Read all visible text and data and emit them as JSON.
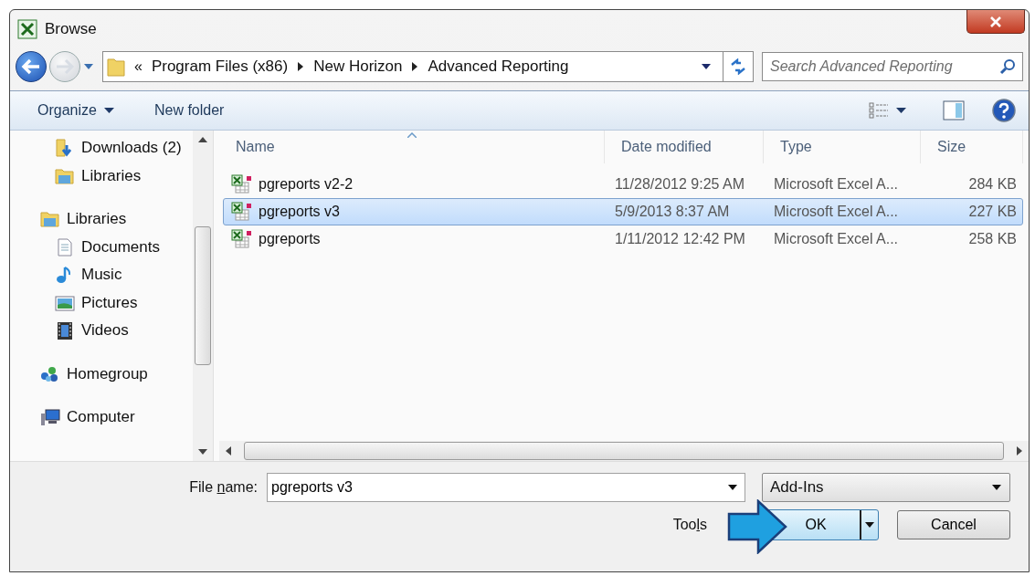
{
  "window": {
    "title": "Browse"
  },
  "address": {
    "path": [
      "Program Files (x86)",
      "New Horizon",
      "Advanced Reporting"
    ],
    "overflow": "«"
  },
  "search": {
    "placeholder": "Search Advanced Reporting"
  },
  "toolbar": {
    "organize": "Organize",
    "new_folder": "New folder"
  },
  "sidebar": {
    "sections": [
      {
        "children": [
          {
            "label": "Downloads (2)",
            "kind": "downloads"
          },
          {
            "label": "Libraries",
            "kind": "libraries"
          }
        ]
      },
      {
        "label": "Libraries",
        "kind": "libraries",
        "children": [
          {
            "label": "Documents",
            "kind": "documents"
          },
          {
            "label": "Music",
            "kind": "music"
          },
          {
            "label": "Pictures",
            "kind": "pictures"
          },
          {
            "label": "Videos",
            "kind": "videos"
          }
        ]
      },
      {
        "label": "Homegroup",
        "kind": "homegroup"
      },
      {
        "label": "Computer",
        "kind": "computer"
      }
    ]
  },
  "table": {
    "columns": [
      {
        "label": "Name",
        "sorted": true
      },
      {
        "label": "Date modified",
        "sorted": false
      },
      {
        "label": "Type",
        "sorted": false
      },
      {
        "label": "Size",
        "sorted": false
      }
    ],
    "rows": [
      {
        "name": "pgreports v2-2",
        "date": "11/28/2012 9:25 AM",
        "type": "Microsoft Excel A...",
        "size": "284 KB",
        "selected": false
      },
      {
        "name": "pgreports v3",
        "date": "5/9/2013 8:37 AM",
        "type": "Microsoft Excel A...",
        "size": "227 KB",
        "selected": true
      },
      {
        "name": "pgreports",
        "date": "1/11/2012 12:42 PM",
        "type": "Microsoft Excel A...",
        "size": "258 KB",
        "selected": false
      }
    ]
  },
  "file_name": {
    "label_before": "File ",
    "access_key": "n",
    "label_after": "ame:",
    "value": "pgreports v3"
  },
  "file_type": {
    "value": "Add-Ins"
  },
  "tools": {
    "label_before": "Too",
    "access_key": "l",
    "label_after": "s"
  },
  "buttons": {
    "ok": "OK",
    "cancel": "Cancel"
  },
  "annotation": {
    "kind": "arrow"
  }
}
